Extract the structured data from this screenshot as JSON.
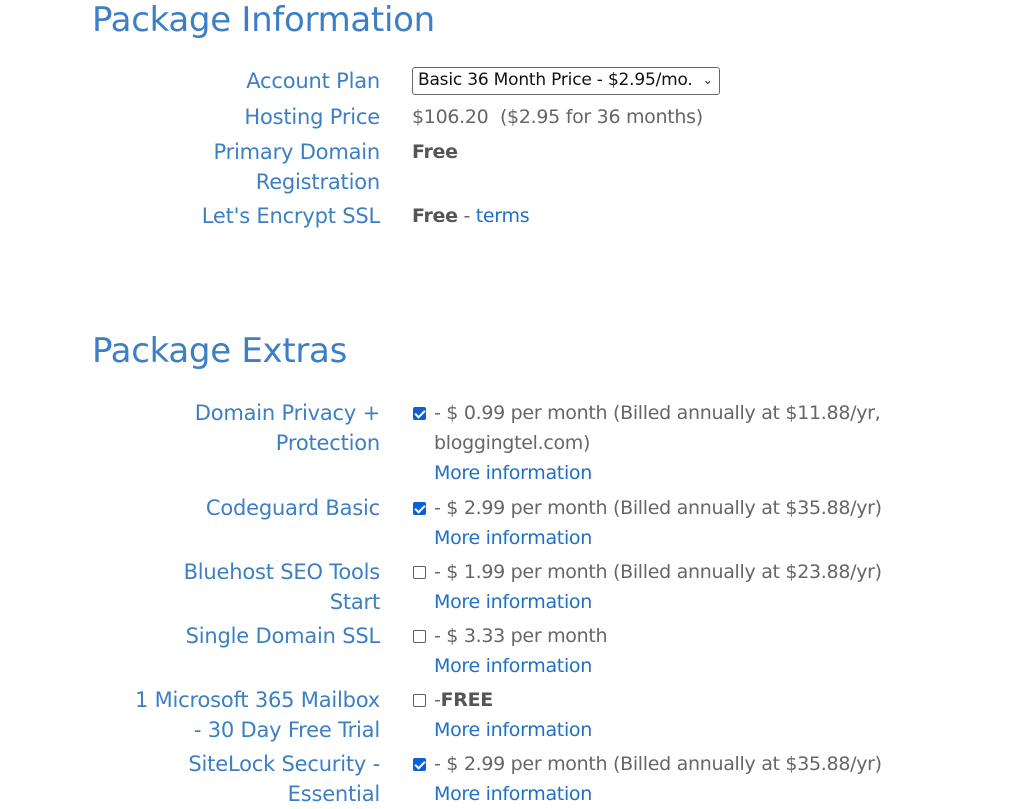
{
  "package_information": {
    "title": "Package Information",
    "account_plan": {
      "label": "Account Plan",
      "selected": "Basic 36 Month Price - $2.95/mo."
    },
    "hosting_price": {
      "label": "Hosting Price",
      "value": "$106.20  ($2.95 for 36 months)"
    },
    "primary_domain": {
      "label_line1": "Primary Domain",
      "label_line2": "Registration",
      "value": "Free"
    },
    "ssl": {
      "label": "Let's Encrypt SSL",
      "value": "Free",
      "separator": " - ",
      "link": "terms"
    }
  },
  "package_extras": {
    "title": "Package Extras",
    "more_info_label": "More information",
    "items": [
      {
        "label_line1": "Domain Privacy +",
        "label_line2": "Protection",
        "checked": true,
        "text_line1": "- $ 0.99 per month (Billed annually at $11.88/yr,",
        "text_line2": "bloggingtel.com)",
        "more": "More information"
      },
      {
        "label_line1": "Codeguard Basic",
        "checked": true,
        "text_line1": "- $ 2.99 per month (Billed annually at $35.88/yr)",
        "more": "More information"
      },
      {
        "label_line1": "Bluehost SEO Tools",
        "label_line2": "Start",
        "checked": false,
        "text_line1": "- $ 1.99 per month (Billed annually at $23.88/yr)",
        "more": "More information"
      },
      {
        "label_line1": "Single Domain SSL",
        "checked": false,
        "text_line1": "- $ 3.33 per month",
        "more": "More information"
      },
      {
        "label_line1": "1 Microsoft 365 Mailbox",
        "label_line2": "- 30 Day Free Trial",
        "checked": false,
        "text_prefix": "-",
        "text_bold": "FREE",
        "more": "More information"
      },
      {
        "label_line1": "SiteLock Security -",
        "label_line2": "Essential",
        "checked": true,
        "text_line1": "- $ 2.99 per month (Billed annually at $35.88/yr)",
        "more": "More information"
      }
    ]
  }
}
